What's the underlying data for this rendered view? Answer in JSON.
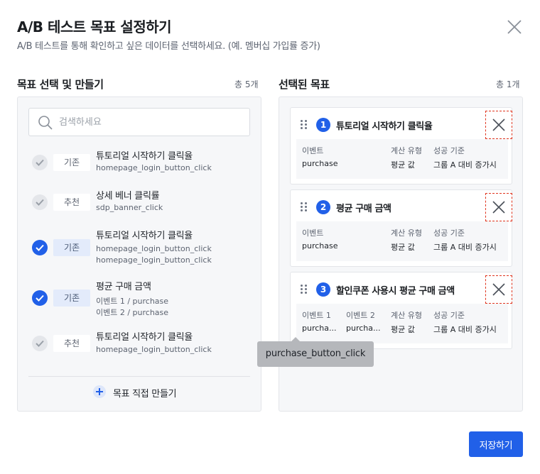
{
  "dialog": {
    "title": "A/B 테스트 목표 설정하기",
    "subtitle": "A/B 테스트를 통해 확인하고 싶은 데이터를 선택하세요. (예. 멤버십 가입률 증가)",
    "close_icon": "close-icon",
    "save_label": "저장하기"
  },
  "left": {
    "title": "목표 선택 및 만들기",
    "count": "총 5개",
    "search_placeholder": "검색하세요",
    "create_label": "목표 직접 만들기",
    "items": [
      {
        "checked": false,
        "tag": "기존",
        "name": "튜토리얼 시작하기 클릭율",
        "events": [
          "homepage_login_button_click"
        ]
      },
      {
        "checked": false,
        "tag": "추천",
        "name": "상세 베너 클릭률",
        "events": [
          "sdp_banner_click"
        ]
      },
      {
        "checked": true,
        "tag": "기존",
        "name": "튜토리얼 시작하기 클릭율",
        "events": [
          "homepage_login_button_click",
          "homepage_login_button_click"
        ]
      },
      {
        "checked": true,
        "tag": "기존",
        "name": "평균 구매 금액",
        "events": [
          "이벤트 1 / purchase",
          "이벤트 2 /  purchase"
        ]
      },
      {
        "checked": false,
        "tag": "추천",
        "name": "튜토리얼 시작하기 클릭율",
        "events": [
          "homepage_login_button_click"
        ]
      }
    ]
  },
  "right": {
    "title": "선택된 목표",
    "count": "총 1개",
    "cards": [
      {
        "number": "1",
        "title": "튜토리얼 시작하기 클릭율",
        "labels": [
          "이벤트",
          "계산 유형",
          "성공 기준"
        ],
        "values": [
          "purchase",
          "평균 값",
          "그룹 A 대비 증가시"
        ]
      },
      {
        "number": "2",
        "title": "평균 구매 금액",
        "labels": [
          "이벤트",
          "계산 유형",
          "성공 기준"
        ],
        "values": [
          "purchase",
          "평균 값",
          "그룹 A 대비 증가시"
        ]
      },
      {
        "number": "3",
        "title": "할인쿠폰 사용시 평균 구매 금액",
        "labels": [
          "이벤트 1",
          "이벤트 2",
          "계산 유형",
          "성공 기준"
        ],
        "values": [
          "purcha...",
          "purcha...",
          "평균 값",
          "그룹 A 대비 증가시"
        ]
      }
    ]
  },
  "tooltip": "purchase_button_click",
  "colors": {
    "primary": "#2160e8",
    "highlight": "#e0351f"
  }
}
